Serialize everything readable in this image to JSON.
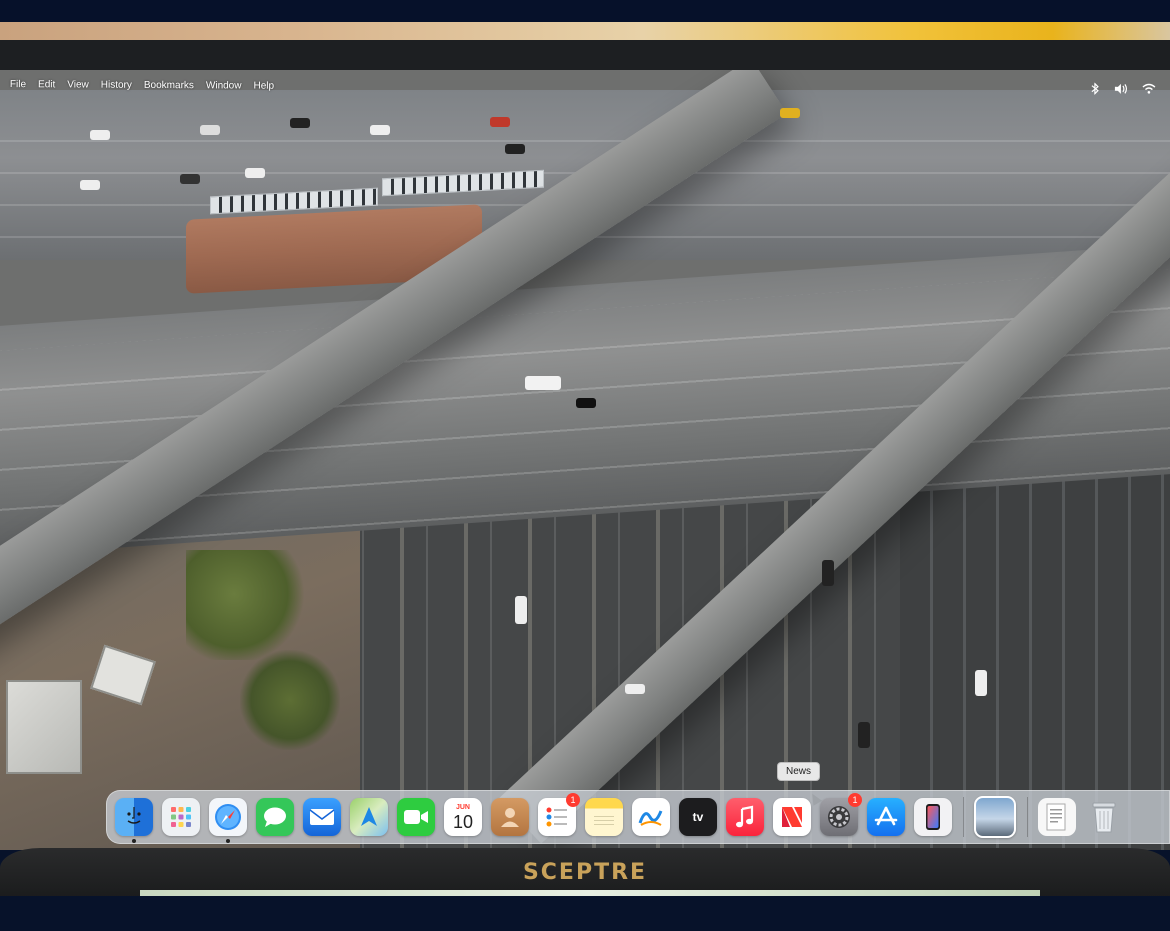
{
  "menubar": {
    "items": [
      "File",
      "Edit",
      "View",
      "History",
      "Bookmarks",
      "Window",
      "Help"
    ],
    "status_icons": [
      "bluetooth-icon",
      "volume-icon",
      "wifi-icon"
    ]
  },
  "dock": {
    "apps": [
      {
        "name": "finder",
        "color": "#1e88e5"
      },
      {
        "name": "launchpad",
        "color": "#eceff1"
      },
      {
        "name": "safari",
        "color": "#e3f2fd"
      },
      {
        "name": "messages",
        "color": "#34c759"
      },
      {
        "name": "mail",
        "color": "#1a73e8"
      },
      {
        "name": "maps",
        "color": "#8bc34a"
      },
      {
        "name": "facetime",
        "color": "#2ecc40"
      },
      {
        "name": "calendar",
        "color": "#ffffff"
      },
      {
        "name": "contacts",
        "color": "#c58b55"
      },
      {
        "name": "reminders",
        "color": "#ffffff"
      },
      {
        "name": "notes",
        "color": "#fff6c8"
      },
      {
        "name": "freeform",
        "color": "#ffffff"
      },
      {
        "name": "apple-tv",
        "color": "#1c1c1e"
      },
      {
        "name": "music",
        "color": "#fc3c44"
      },
      {
        "name": "news",
        "color": "#ffffff"
      },
      {
        "name": "system-settings",
        "color": "#8e8e93"
      },
      {
        "name": "app-store",
        "color": "#1e90ff"
      },
      {
        "name": "iphone-mirroring",
        "color": "#f0f0f0"
      }
    ],
    "calendar": {
      "month": "JUN",
      "day": "10"
    },
    "apple_tv_label": "tv",
    "reminders_badge": "1",
    "settings_badge": "1",
    "tooltip": "News"
  },
  "monitor": {
    "brand": "SCEPTRE"
  }
}
